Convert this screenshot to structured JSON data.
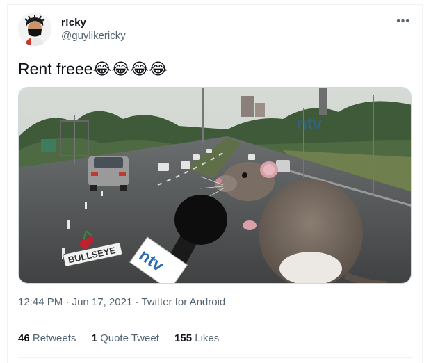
{
  "user": {
    "display_name": "r!cky",
    "handle": "@guylikericky"
  },
  "tweet": {
    "text": "Rent freee😂😂😂😂"
  },
  "media": {
    "watermark": "ntv",
    "mic_logo": "ntv",
    "bottom_logo": "BULLSEYE"
  },
  "meta": {
    "time": "12:44 PM",
    "sep1": " · ",
    "date": "Jun 17, 2021",
    "sep2": " · ",
    "source": "Twitter for Android"
  },
  "stats": {
    "retweets_count": "46",
    "retweets_label": "Retweets",
    "quotes_count": "1",
    "quotes_label": "Quote Tweet",
    "likes_count": "155",
    "likes_label": "Likes"
  },
  "icons": {
    "more": "more-icon",
    "avatar": "avatar-icon"
  },
  "colors": {
    "secondary_text": "#536471",
    "primary_text": "#0f1419",
    "divider": "#eff3f4"
  }
}
